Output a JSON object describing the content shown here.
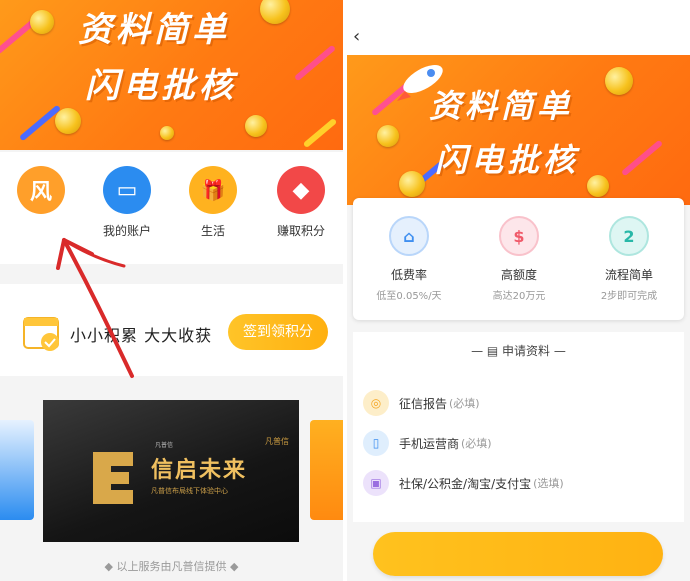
{
  "left": {
    "banner": {
      "line1": "资料简单",
      "line2": "闪电批核"
    },
    "icons": [
      {
        "glyph": "风",
        "label": "",
        "color": "#ff9f2a"
      },
      {
        "glyph": "▭",
        "label": "我的账户",
        "color": "#2b8cf0"
      },
      {
        "glyph": "🎁",
        "label": "生活",
        "color": "#ffb21f"
      },
      {
        "glyph": "◆",
        "label": "赚取积分",
        "color": "#f24848"
      }
    ],
    "checkin": {
      "text": "小小积累  大大收获",
      "button": "签到领积分"
    },
    "promo": {
      "title": "信启未来",
      "subtitle": "凡普信布局线下体验中心",
      "brand": "凡普信",
      "corner": "凡普信"
    },
    "footer": "◆ 以上服务由凡普信提供 ◆"
  },
  "right": {
    "back_glyph": "‹",
    "banner": {
      "line1": "资料简单",
      "line2": "闪电批核"
    },
    "features": [
      {
        "title": "低费率",
        "sub": "低至0.05%/天",
        "glyph": "⌂",
        "color": "#3f8ff0",
        "bg": "#e5f0fd"
      },
      {
        "title": "高额度",
        "sub": "高达20万元",
        "glyph": "$",
        "color": "#f05a6a",
        "bg": "#fde6ea"
      },
      {
        "title": "流程简单",
        "sub": "2步即可完成",
        "glyph": "2",
        "color": "#28b8a8",
        "bg": "#def6f3"
      }
    ],
    "section_title": "— ▤ 申请资料 —",
    "items": [
      {
        "label": "征信报告",
        "req": "(必填)",
        "glyph": "◎",
        "color": "#f5a623",
        "bg": "#fdeec9"
      },
      {
        "label": "手机运营商",
        "req": "(必填)",
        "glyph": "▯",
        "color": "#3f8ff0",
        "bg": "#dfeefd"
      },
      {
        "label": "社保/公积金/淘宝/支付宝",
        "req": "(选填)",
        "glyph": "▣",
        "color": "#9a6ee0",
        "bg": "#ece2fb"
      }
    ]
  },
  "colors": {
    "accent": "#ff8a16",
    "button": "#ffbc1c",
    "arrow": "#d92a2a"
  }
}
